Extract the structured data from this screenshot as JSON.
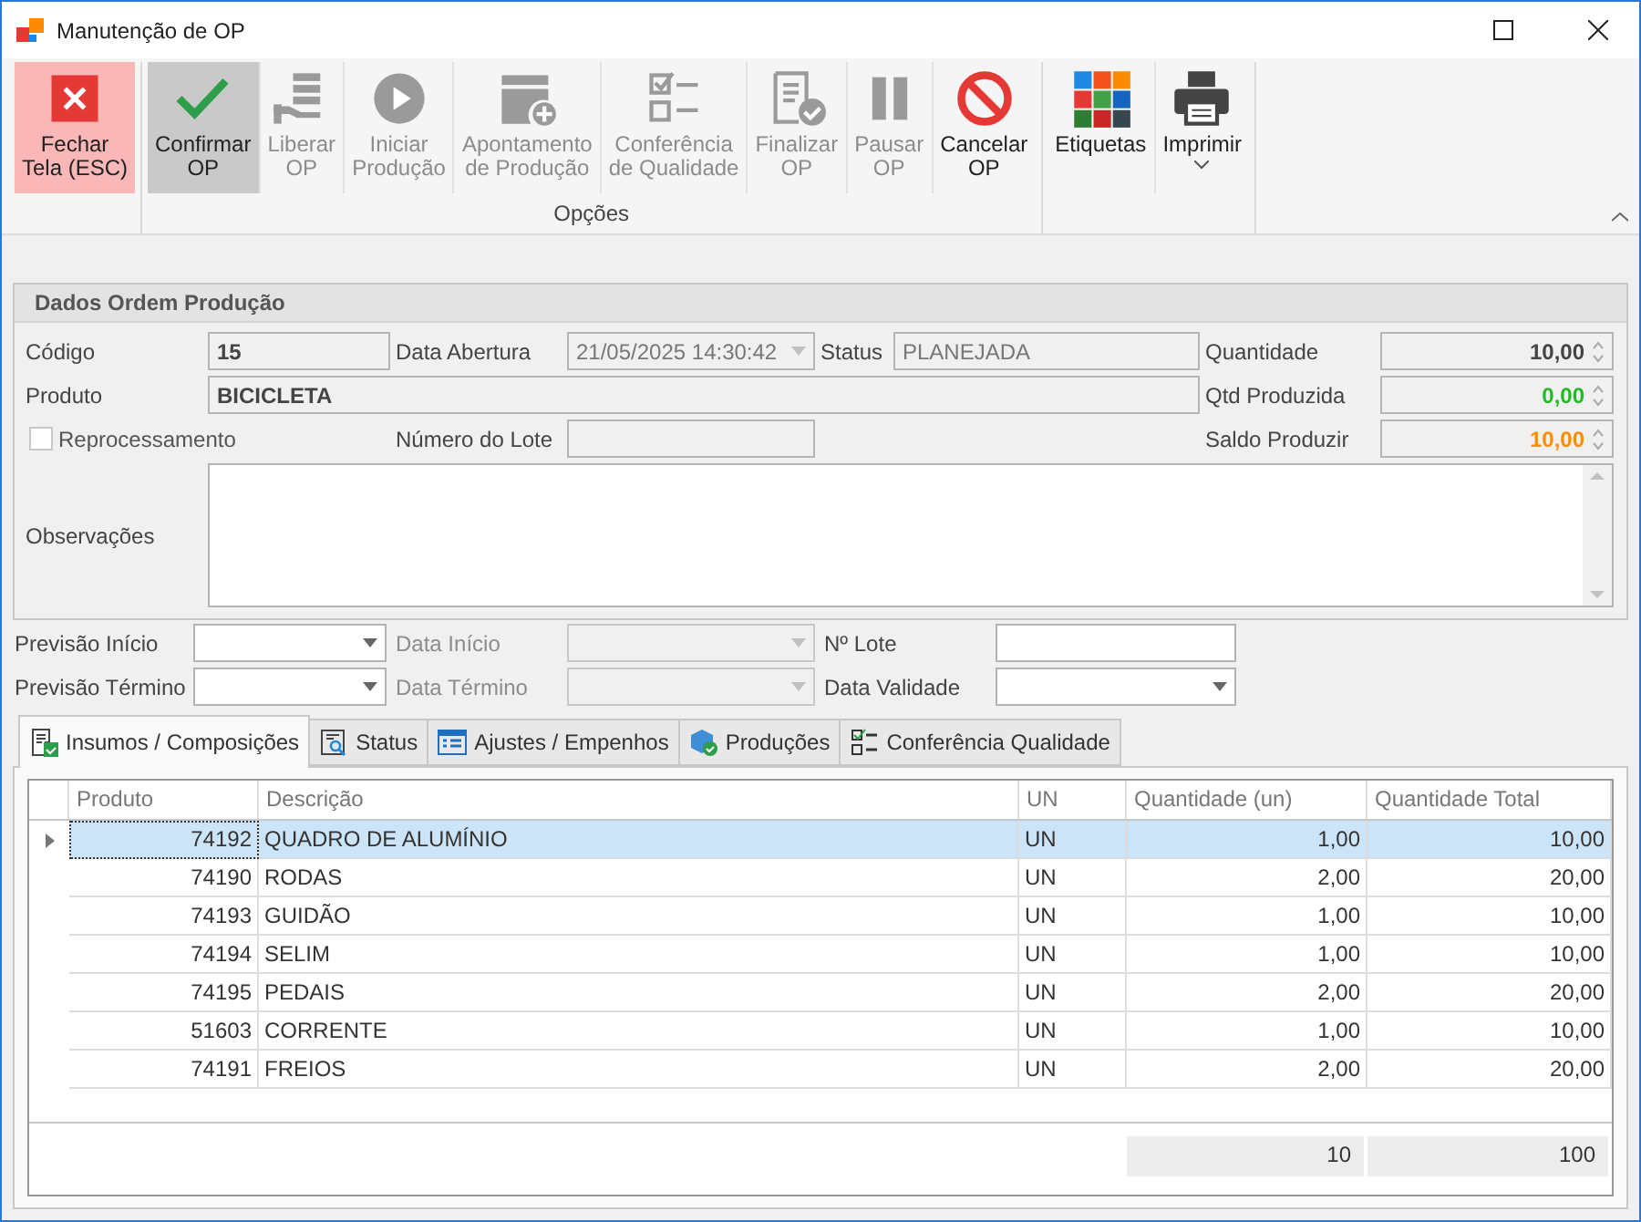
{
  "window": {
    "title": "Manutenção de OP"
  },
  "toolbar": {
    "groups": [
      {
        "buttons": [
          {
            "kind": "close",
            "lines": [
              "Fechar",
              "Tela (ESC)"
            ],
            "disabled": false,
            "selected": false
          }
        ]
      },
      {
        "label": "Opções",
        "buttons": [
          {
            "kind": "confirm",
            "lines": [
              "Confirmar",
              "OP"
            ],
            "disabled": false,
            "selected": true
          },
          {
            "kind": "release",
            "lines": [
              "Liberar",
              "OP"
            ],
            "disabled": true,
            "selected": false
          },
          {
            "kind": "play",
            "lines": [
              "Iniciar",
              "Produção"
            ],
            "disabled": true,
            "selected": false
          },
          {
            "kind": "appointment",
            "lines": [
              "Apontamento",
              "de Produção"
            ],
            "disabled": true,
            "selected": false
          },
          {
            "kind": "checklist",
            "lines": [
              "Conferência",
              "de Qualidade"
            ],
            "disabled": true,
            "selected": false
          },
          {
            "kind": "finalize",
            "lines": [
              "Finalizar",
              "OP"
            ],
            "disabled": true,
            "selected": false
          },
          {
            "kind": "pause",
            "lines": [
              "Pausar",
              "OP"
            ],
            "disabled": true,
            "selected": false
          },
          {
            "kind": "cancel",
            "lines": [
              "Cancelar",
              "OP"
            ],
            "disabled": false,
            "selected": false
          }
        ]
      },
      {
        "buttons": [
          {
            "kind": "labels",
            "lines": [
              "Etiquetas"
            ],
            "disabled": false,
            "selected": false
          },
          {
            "kind": "print",
            "lines": [
              "Imprimir"
            ],
            "disabled": false,
            "selected": false,
            "dropdown": true
          }
        ]
      }
    ]
  },
  "order": {
    "title": "Dados Ordem Produção",
    "code": {
      "label": "Código",
      "value": "15"
    },
    "opened": {
      "label": "Data Abertura",
      "value": "21/05/2025 14:30:42"
    },
    "status": {
      "label": "Status",
      "value": "PLANEJADA"
    },
    "product": {
      "label": "Produto",
      "value": "BICICLETA"
    },
    "reprocess": {
      "label": "Reprocessamento",
      "checked": false
    },
    "lot_number": {
      "label": "Número do Lote"
    },
    "notes": {
      "label": "Observações"
    },
    "quantities": [
      {
        "label": "Quantidade",
        "value": "10,00",
        "color": "#444444"
      },
      {
        "label": "Qtd Produzida",
        "value": "0,00",
        "color": "#22bb22"
      },
      {
        "label": "Saldo Produzir",
        "value": "10,00",
        "color": "#ff8c00"
      }
    ]
  },
  "schedule": [
    {
      "label": "Previsão Início",
      "kind": "combo",
      "disabled": false
    },
    {
      "label": "Data Início",
      "kind": "combo",
      "disabled": true
    },
    {
      "label": "Nº Lote",
      "kind": "text",
      "disabled": false
    },
    {
      "label": "Previsão Término",
      "kind": "combo",
      "disabled": false
    },
    {
      "label": "Data Término",
      "kind": "combo",
      "disabled": true
    },
    {
      "label": "Data Validade",
      "kind": "combo",
      "disabled": false
    }
  ],
  "tabs": [
    {
      "label": "Insumos / Composições",
      "kind": "doc-check",
      "selected": true
    },
    {
      "label": "Status",
      "kind": "doc-search",
      "selected": false
    },
    {
      "label": "Ajustes / Empenhos",
      "kind": "list",
      "selected": false
    },
    {
      "label": "Produções",
      "kind": "box-check",
      "selected": false
    },
    {
      "label": "Conferência Qualidade",
      "kind": "checklist",
      "selected": false
    }
  ],
  "table": {
    "columns": [
      "Produto",
      "Descrição",
      "UN",
      "Quantidade (un)",
      "Quantidade Total"
    ],
    "rows": [
      {
        "cells": [
          "74192",
          "QUADRO DE ALUMÍNIO",
          "UN",
          "1,00",
          "10,00"
        ],
        "selected": true
      },
      {
        "cells": [
          "74190",
          "RODAS",
          "UN",
          "2,00",
          "20,00"
        ],
        "selected": false
      },
      {
        "cells": [
          "74193",
          "GUIDÃO",
          "UN",
          "1,00",
          "10,00"
        ],
        "selected": false
      },
      {
        "cells": [
          "74194",
          "SELIM",
          "UN",
          "1,00",
          "10,00"
        ],
        "selected": false
      },
      {
        "cells": [
          "74195",
          "PEDAIS",
          "UN",
          "2,00",
          "20,00"
        ],
        "selected": false
      },
      {
        "cells": [
          "51603",
          "CORRENTE",
          "UN",
          "1,00",
          "10,00"
        ],
        "selected": false
      },
      {
        "cells": [
          "74191",
          "FREIOS",
          "UN",
          "2,00",
          "20,00"
        ],
        "selected": false
      }
    ],
    "totals": [
      "10",
      "100"
    ]
  }
}
